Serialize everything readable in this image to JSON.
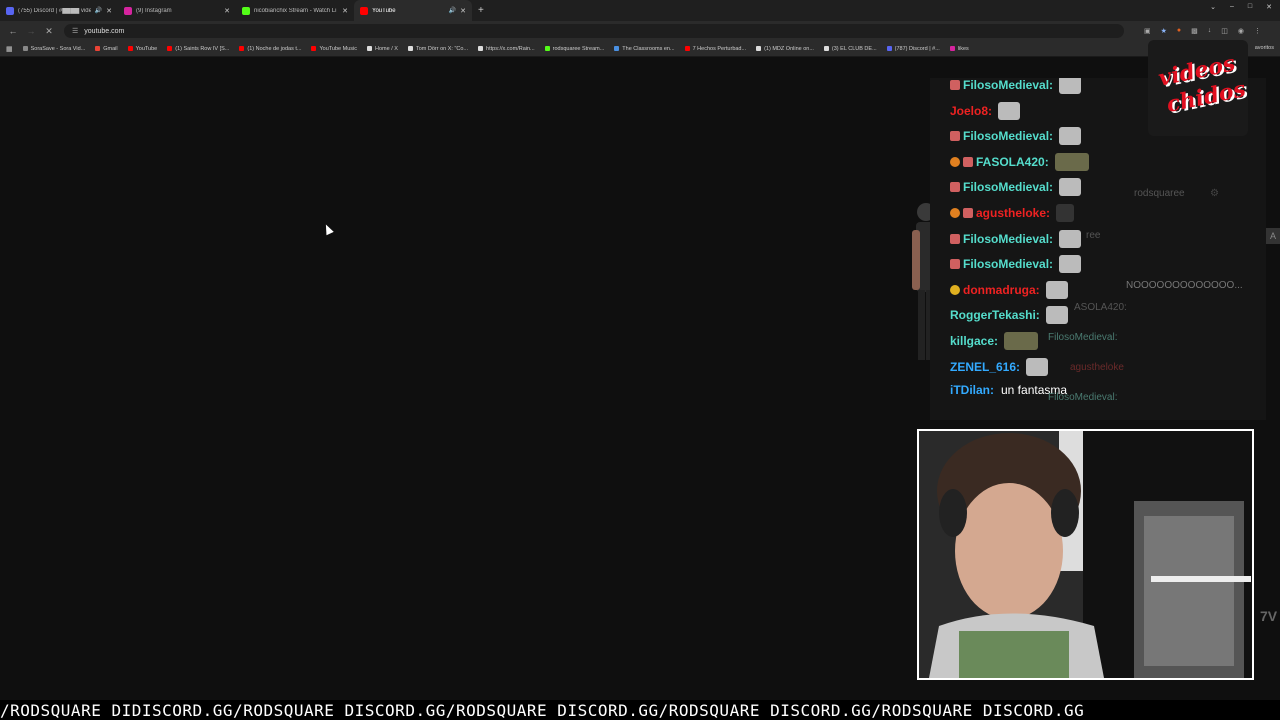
{
  "browser": {
    "tabs": [
      {
        "title": "(755) Discord | #████ videos",
        "color": "#5865f2",
        "audio": true,
        "active": false
      },
      {
        "title": "(9) Instagram",
        "color": "#d6249f",
        "audio": false,
        "active": false
      },
      {
        "title": "nicobianchix Stream - Watch Li",
        "color": "#53fc18",
        "audio": false,
        "active": false
      },
      {
        "title": "YouTube",
        "color": "#ff0000",
        "audio": true,
        "active": true
      }
    ],
    "new_tab": "+",
    "window_controls": [
      "⌄",
      "–",
      "□",
      "✕"
    ],
    "address": "youtube.com",
    "bookmarks": [
      {
        "label": "SoraSave - Sora Vid...",
        "color": "#888888"
      },
      {
        "label": "Gmail",
        "color": "#ea4335"
      },
      {
        "label": "YouTube",
        "color": "#ff0000"
      },
      {
        "label": "(1) Saints Row IV [S...",
        "color": "#ff0000"
      },
      {
        "label": "(1) Noche de jodas t...",
        "color": "#ff0000"
      },
      {
        "label": "YouTube Music",
        "color": "#ff0000"
      },
      {
        "label": "Home / X",
        "color": "#dddddd"
      },
      {
        "label": "Tom Dörr on X: \"Co...",
        "color": "#dddddd"
      },
      {
        "label": "https://x.com/Rain...",
        "color": "#dddddd"
      },
      {
        "label": "rodsquaree Stream...",
        "color": "#53fc18"
      },
      {
        "label": "The Classrooms en...",
        "color": "#4a90e2"
      },
      {
        "label": "7 Hechos Perturbad...",
        "color": "#ff0000"
      },
      {
        "label": "(1) MDZ Online on...",
        "color": "#dddddd"
      },
      {
        "label": "(3) EL CLUB DE...",
        "color": "#dddddd"
      },
      {
        "label": "(787) Discord | #...",
        "color": "#5865f2"
      },
      {
        "label": "likes",
        "color": "#d6249f"
      }
    ],
    "favorites_label": "avoritos"
  },
  "overlay_logo": {
    "line1": "videos",
    "line2": "chidos"
  },
  "chat": {
    "messages": [
      {
        "user": "FilosoMedieval:",
        "color": "#55ddcc",
        "text": "",
        "emote": "light"
      },
      {
        "user": "Joelo8:",
        "color": "#ee2222",
        "text": "",
        "emote": "light"
      },
      {
        "user": "FilosoMedieval:",
        "color": "#55ddcc",
        "text": "",
        "emote": "light"
      },
      {
        "user": "FASOLA420:",
        "color": "#55ddcc",
        "text": "",
        "emote": "green"
      },
      {
        "user": "FilosoMedieval:",
        "color": "#55ddcc",
        "text": "",
        "emote": "light"
      },
      {
        "user": "agustheloke:",
        "color": "#ee2222",
        "text": "",
        "emote": "dark"
      },
      {
        "user": "FilosoMedieval:",
        "color": "#55ddcc",
        "text": "",
        "emote": "light"
      },
      {
        "user": "FilosoMedieval:",
        "color": "#55ddcc",
        "text": "",
        "emote": "light"
      },
      {
        "user": "donmadruga:",
        "color": "#ee2222",
        "text": "",
        "emote": "light"
      },
      {
        "user": "RoggerTekashi:",
        "color": "#55ddcc",
        "text": "",
        "emote": "light"
      },
      {
        "user": "killgace:",
        "color": "#55ddcc",
        "text": "",
        "emote": "green"
      },
      {
        "user": "ZENEL_616:",
        "color": "#33aaff",
        "text": "",
        "emote": "light"
      },
      {
        "user": "iTDilan:",
        "color": "#33aaff",
        "text": "un fantasma",
        "emote": ""
      }
    ],
    "faded": {
      "channel": "rodsquaree",
      "ree": "ree",
      "noo": "NOOOOOOOOOOOOO...",
      "fasola": "ASOLA420:",
      "filoso1": "FilosoMedieval:",
      "agus": "agustheloke",
      "filoso2": "FilosoMedieval:"
    }
  },
  "ticker": {
    "text": "/RODSQUARE DIDISCORD.GG/RODSQUARE DISCORD.GG/RODSQUARE DISCORD.GG/RODSQUARE DISCORD.GG/RODSQUARE DISCORD.GG"
  },
  "side_glyphs": {
    "a": "A",
    "seven": "7V"
  }
}
